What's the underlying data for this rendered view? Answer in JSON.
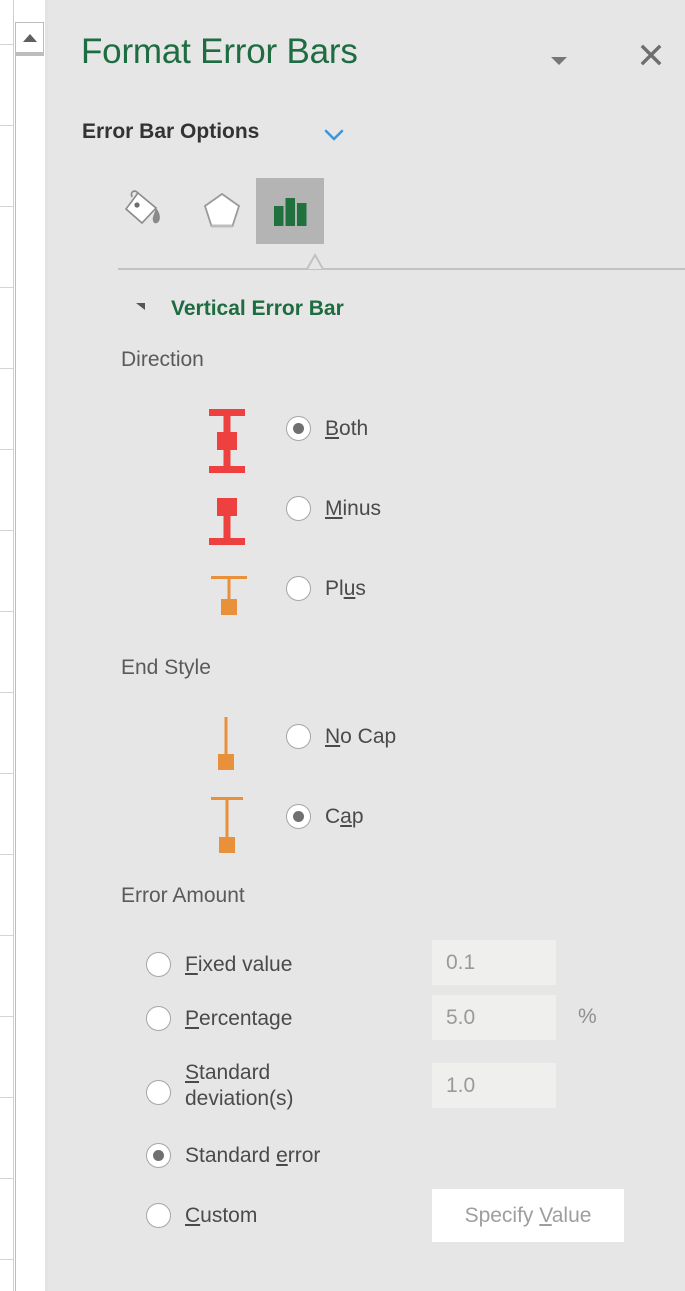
{
  "window": {
    "pane_title": "Format Error Bars",
    "pane_menu_icon": "chevron-down-icon",
    "close_icon": "close-icon"
  },
  "subheader": {
    "label": "Error Bar Options",
    "caret_icon": "chevron-down-icon"
  },
  "tabs": [
    {
      "name": "fill-and-line",
      "icon": "paint-bucket-icon",
      "selected": false
    },
    {
      "name": "effects",
      "icon": "pentagon-icon",
      "selected": false
    },
    {
      "name": "error-bar-options",
      "icon": "bar-chart-icon",
      "selected": true
    }
  ],
  "section": {
    "title": "Vertical Error Bar",
    "expanded": true
  },
  "direction": {
    "label": "Direction",
    "options": [
      {
        "label": "Both",
        "accel": "B",
        "selected": true,
        "preview": "both-error-bar-preview"
      },
      {
        "label": "Minus",
        "accel": "M",
        "selected": false,
        "preview": "minus-error-bar-preview"
      },
      {
        "label": "Plus",
        "accel": "u",
        "selected": false,
        "preview": "plus-error-bar-preview"
      }
    ]
  },
  "end_style": {
    "label": "End Style",
    "options": [
      {
        "label": "No Cap",
        "accel": "N",
        "selected": false,
        "preview": "no-cap-preview"
      },
      {
        "label": "Cap",
        "accel": "a",
        "selected": true,
        "preview": "cap-preview"
      }
    ]
  },
  "error_amount": {
    "label": "Error Amount",
    "options": [
      {
        "label": "Fixed value",
        "accel": "F",
        "selected": false,
        "value": "0.1",
        "suffix": "",
        "disabled": true
      },
      {
        "label": "Percentage",
        "accel": "P",
        "selected": false,
        "value": "5.0",
        "suffix": "%",
        "disabled": true
      },
      {
        "label": "Standard deviation(s)",
        "accel": "S",
        "selected": false,
        "value": "1.0",
        "suffix": "",
        "disabled": true
      },
      {
        "label": "Standard error",
        "accel": "e",
        "selected": true,
        "value": "",
        "suffix": "",
        "disabled": true
      },
      {
        "label": "Custom",
        "accel": "C",
        "selected": false,
        "value": "",
        "suffix": "",
        "disabled": false
      }
    ],
    "custom_button": {
      "label": "Specify Value",
      "accel": "V"
    }
  },
  "colors": {
    "pane_bg": "#e6e6e6",
    "accent_green": "#1e6c41",
    "accent_blue": "#3a96dd",
    "error_red": "#ef4040",
    "error_orange": "#e8903a",
    "field_bg": "#efefed"
  },
  "scrollbar": {
    "up_arrow_icon": "triangle-up-icon"
  }
}
